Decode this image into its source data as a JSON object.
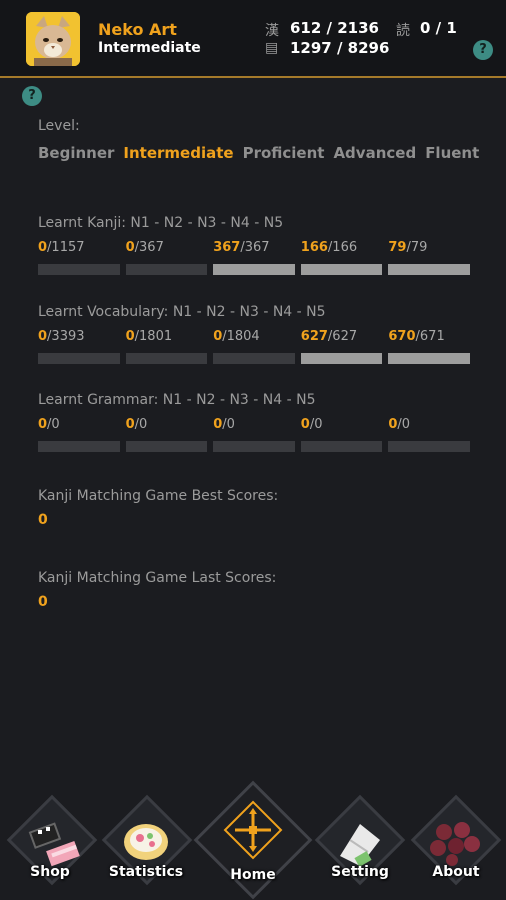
{
  "header": {
    "name": "Neko Art",
    "level": "Intermediate",
    "kanji_icon": "漢",
    "kanji_stat": "612 / 2136",
    "reading_icon": "読",
    "reading_stat": "0 / 1",
    "vocab_icon": "▤",
    "vocab_stat": "1297 / 8296",
    "help": "?"
  },
  "page_help": "?",
  "level_section": {
    "label": "Level:",
    "levels": [
      "Beginner",
      "Intermediate",
      "Proficient",
      "Advanced",
      "Fluent"
    ],
    "active": "Intermediate"
  },
  "kanji": {
    "label": "Learnt Kanji: N1 - N2 - N3 - N4 - N5",
    "items": [
      {
        "learnt": "0",
        "total": "/1157",
        "fraction": 0
      },
      {
        "learnt": "0",
        "total": "/367",
        "fraction": 0
      },
      {
        "learnt": "367",
        "total": "/367",
        "fraction": 1
      },
      {
        "learnt": "166",
        "total": "/166",
        "fraction": 1
      },
      {
        "learnt": "79",
        "total": "/79",
        "fraction": 1
      }
    ]
  },
  "vocabulary": {
    "label": "Learnt Vocabulary: N1 - N2 - N3 - N4 - N5",
    "items": [
      {
        "learnt": "0",
        "total": "/3393",
        "fraction": 0
      },
      {
        "learnt": "0",
        "total": "/1801",
        "fraction": 0
      },
      {
        "learnt": "0",
        "total": "/1804",
        "fraction": 0
      },
      {
        "learnt": "627",
        "total": "/627",
        "fraction": 1
      },
      {
        "learnt": "670",
        "total": "/671",
        "fraction": 0.9985
      }
    ]
  },
  "grammar": {
    "label": "Learnt Grammar: N1 - N2 - N3 - N4 - N5",
    "items": [
      {
        "learnt": "0",
        "total": "/0",
        "fraction": 0
      },
      {
        "learnt": "0",
        "total": "/0",
        "fraction": 0
      },
      {
        "learnt": "0",
        "total": "/0",
        "fraction": 0
      },
      {
        "learnt": "0",
        "total": "/0",
        "fraction": 0
      },
      {
        "learnt": "0",
        "total": "/0",
        "fraction": 0
      }
    ]
  },
  "best_scores": {
    "label": "Kanji Matching Game Best Scores:",
    "value": "0"
  },
  "last_scores": {
    "label": "Kanji Matching Game Last Scores:",
    "value": "0"
  },
  "nav": {
    "shop": "Shop",
    "statistics": "Statistics",
    "home": "Home",
    "setting": "Setting",
    "about": "About"
  },
  "colors": {
    "accent": "#f0a21d",
    "background": "#1b1c20",
    "help": "#3d8c84"
  }
}
